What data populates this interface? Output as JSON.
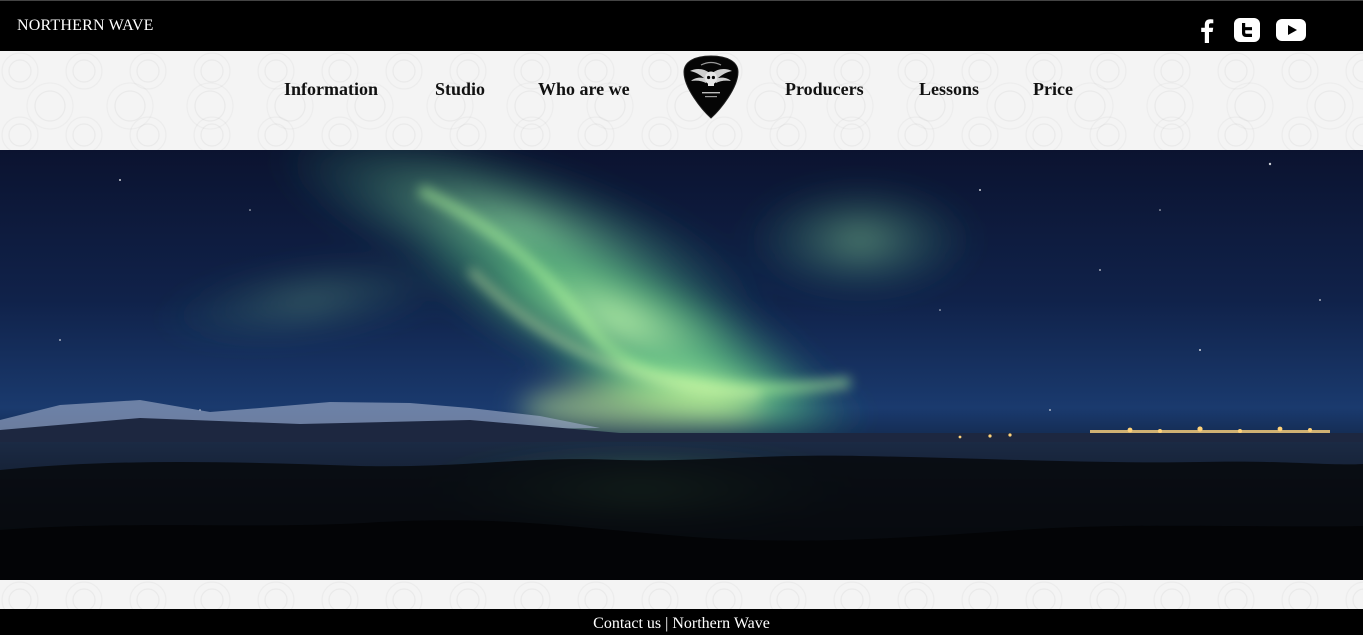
{
  "header": {
    "brand": "NORTHERN WAVE",
    "social": [
      {
        "name": "facebook-icon"
      },
      {
        "name": "twitter-icon"
      },
      {
        "name": "youtube-icon"
      }
    ]
  },
  "nav": {
    "left": [
      "Information",
      "Studio",
      "Who are we"
    ],
    "right": [
      "Producers",
      "Lessons",
      "Price"
    ]
  },
  "hero": {
    "image": "northern lights over a lake at night"
  },
  "footer": {
    "contact": "Contact us",
    "separator": "|",
    "name": "Northern Wave"
  },
  "colors": {
    "bar": "#000000",
    "band": "#f4f4f4",
    "aurora": "#7fe08a"
  }
}
